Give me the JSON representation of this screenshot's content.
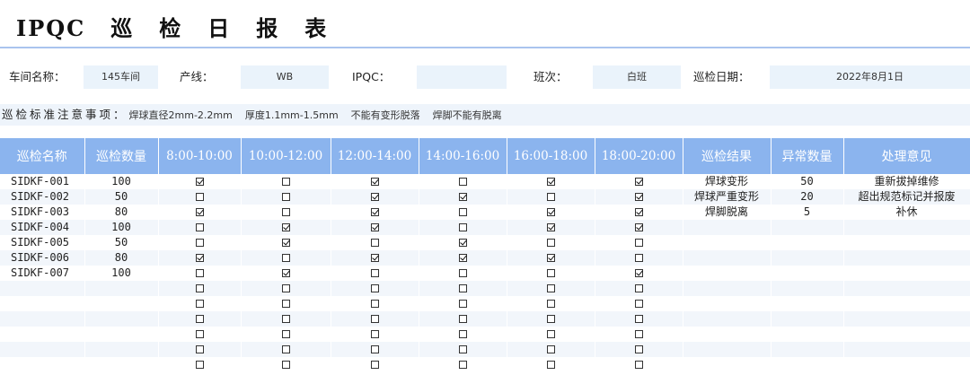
{
  "header": {
    "title_prefix": "IPQC",
    "title_chars": [
      "巡",
      "检",
      "日",
      "报",
      "表"
    ]
  },
  "info": {
    "workshop_label": "车间名称：",
    "workshop_value": "145车间",
    "line_label": "产线：",
    "line_value": "WB",
    "ipqc_label": "IPQC：",
    "ipqc_value": "",
    "shift_label": "班次：",
    "shift_value": "白班",
    "date_label": "巡检日期：",
    "date_value": "2022年8月1日"
  },
  "notes": {
    "label": "巡检标准注意事项：",
    "items": [
      "焊球直径2mm-2.2mm",
      "厚度1.1mm-1.5mm",
      "不能有变形脱落",
      "焊脚不能有脱离"
    ]
  },
  "table": {
    "headers": [
      "巡检名称",
      "巡检数量",
      "8:00-10:00",
      "10:00-12:00",
      "12:00-14:00",
      "14:00-16:00",
      "16:00-18:00",
      "18:00-20:00",
      "巡检结果",
      "异常数量",
      "处理意见"
    ],
    "rows": [
      {
        "name": "SIDKF-001",
        "qty": "100",
        "checks": [
          true,
          false,
          true,
          false,
          true,
          true
        ],
        "result": "焊球变形",
        "abnormal": "50",
        "opinion": "重新拔掉维修"
      },
      {
        "name": "SIDKF-002",
        "qty": "50",
        "checks": [
          false,
          false,
          true,
          true,
          false,
          true
        ],
        "result": "焊球严重变形",
        "abnormal": "20",
        "opinion": "超出规范标记并报废"
      },
      {
        "name": "SIDKF-003",
        "qty": "80",
        "checks": [
          true,
          false,
          true,
          false,
          true,
          true
        ],
        "result": "焊脚脱离",
        "abnormal": "5",
        "opinion": "补休"
      },
      {
        "name": "SIDKF-004",
        "qty": "100",
        "checks": [
          false,
          true,
          true,
          false,
          true,
          true
        ],
        "result": "",
        "abnormal": "",
        "opinion": ""
      },
      {
        "name": "SIDKF-005",
        "qty": "50",
        "checks": [
          false,
          true,
          false,
          true,
          false,
          false
        ],
        "result": "",
        "abnormal": "",
        "opinion": ""
      },
      {
        "name": "SIDKF-006",
        "qty": "80",
        "checks": [
          true,
          false,
          true,
          true,
          true,
          false
        ],
        "result": "",
        "abnormal": "",
        "opinion": ""
      },
      {
        "name": "SIDKF-007",
        "qty": "100",
        "checks": [
          false,
          true,
          false,
          false,
          false,
          true
        ],
        "result": "",
        "abnormal": "",
        "opinion": ""
      },
      {
        "name": "",
        "qty": "",
        "checks": [
          false,
          false,
          false,
          false,
          false,
          false
        ],
        "result": "",
        "abnormal": "",
        "opinion": ""
      },
      {
        "name": "",
        "qty": "",
        "checks": [
          false,
          false,
          false,
          false,
          false,
          false
        ],
        "result": "",
        "abnormal": "",
        "opinion": ""
      },
      {
        "name": "",
        "qty": "",
        "checks": [
          false,
          false,
          false,
          false,
          false,
          false
        ],
        "result": "",
        "abnormal": "",
        "opinion": ""
      },
      {
        "name": "",
        "qty": "",
        "checks": [
          false,
          false,
          false,
          false,
          false,
          false
        ],
        "result": "",
        "abnormal": "",
        "opinion": ""
      },
      {
        "name": "",
        "qty": "",
        "checks": [
          false,
          false,
          false,
          false,
          false,
          false
        ],
        "result": "",
        "abnormal": "",
        "opinion": ""
      },
      {
        "name": "",
        "qty": "",
        "checks": [
          false,
          false,
          false,
          false,
          false,
          false
        ],
        "result": "",
        "abnormal": "",
        "opinion": ""
      }
    ]
  }
}
